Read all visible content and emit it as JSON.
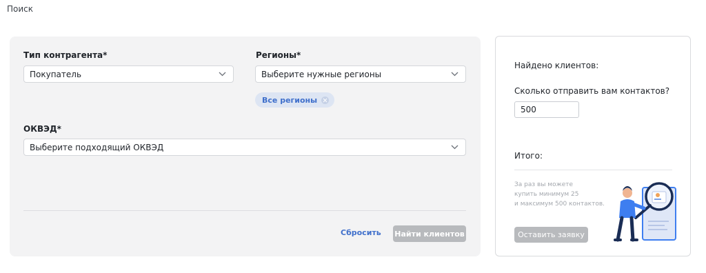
{
  "page": {
    "title": "Поиск"
  },
  "filters": {
    "counterparty_type": {
      "label": "Тип контрагента*",
      "value": "Покупатель"
    },
    "regions": {
      "label": "Регионы*",
      "placeholder": "Выберите нужные регионы",
      "chips": [
        {
          "label": "Все регионы"
        }
      ]
    },
    "okved": {
      "label": "ОКВЭД*",
      "placeholder": "Выберите подходящий ОКВЭД"
    },
    "reset_label": "Сбросить",
    "find_label": "Найти клиентов"
  },
  "summary": {
    "found_label": "Найдено клиентов:",
    "send_question": "Сколько отправить вам контактов?",
    "count_value": "500",
    "total_label": "Итого:",
    "hint_lines": [
      "За раз вы можете",
      "купить минимум 25",
      "и максимум 500 контактов."
    ],
    "request_label": "Оставить заявку"
  },
  "colors": {
    "accent": "#3f6fcb",
    "chip_bg": "#dde5f3",
    "card_bg": "#f3f3f4",
    "disabled_button": "#b8babd",
    "illustration_blue": "#3e7ef0"
  }
}
